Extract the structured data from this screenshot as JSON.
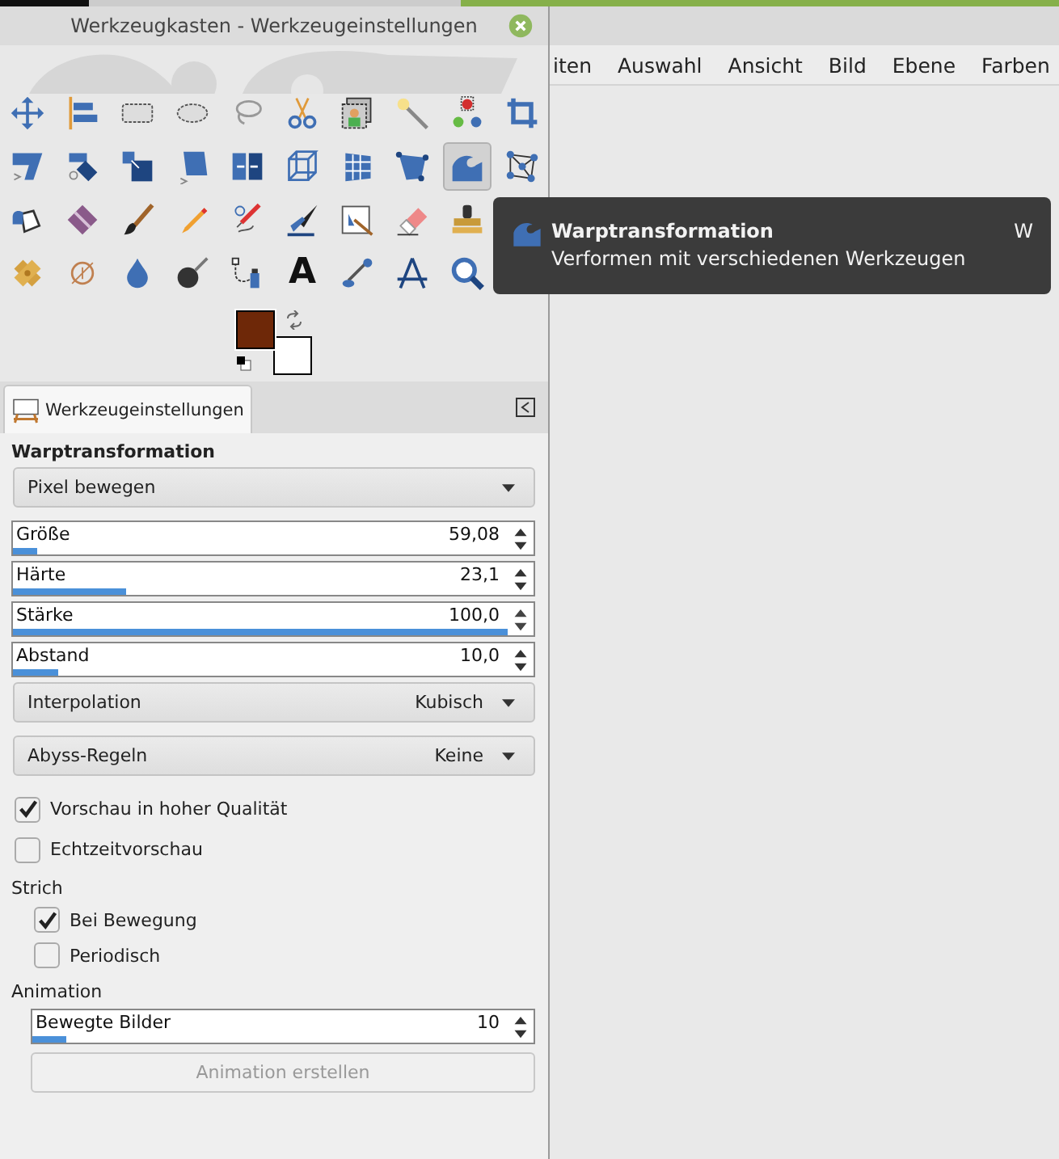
{
  "app_window": {
    "menu_bar": [
      {
        "label": "iten"
      },
      {
        "label": "Auswahl"
      },
      {
        "label": "Ansicht"
      },
      {
        "label": "Bild"
      },
      {
        "label": "Ebene"
      },
      {
        "label": "Farben"
      }
    ]
  },
  "toolbox": {
    "title": "Werkzeugkasten - Werkzeugeinstellungen",
    "tools": [
      {
        "selected": false
      },
      {
        "selected": false
      },
      {
        "selected": false
      },
      {
        "selected": false
      },
      {
        "selected": false
      },
      {
        "selected": false
      },
      {
        "selected": false
      },
      {
        "selected": false
      },
      {
        "selected": false
      },
      {
        "selected": false
      },
      {
        "selected": false
      },
      {
        "selected": false
      },
      {
        "selected": false
      },
      {
        "selected": false
      },
      {
        "selected": false
      },
      {
        "selected": false
      },
      {
        "selected": false
      },
      {
        "selected": false
      },
      {
        "selected": true
      },
      {
        "selected": false
      },
      {
        "selected": false
      },
      {
        "selected": false
      },
      {
        "selected": false
      },
      {
        "selected": false
      },
      {
        "selected": false
      },
      {
        "selected": false
      },
      {
        "selected": false
      },
      {
        "selected": false
      },
      {
        "selected": false
      },
      {
        "selected": false
      },
      {
        "selected": false
      },
      {
        "selected": false
      },
      {
        "selected": false
      },
      {
        "selected": false
      },
      {
        "selected": false,
        "glyph": "A"
      },
      {
        "selected": false
      },
      {
        "selected": false
      },
      {
        "selected": false
      }
    ],
    "swatches": [
      {
        "kind": "foreground",
        "color": "#6e2808"
      },
      {
        "kind": "background",
        "color": "#ffffff"
      }
    ]
  },
  "tabs": [
    {
      "label": "Werkzeugeinstellungen",
      "selected": true
    }
  ],
  "tool_options": {
    "heading": "Warptransformation",
    "options": [
      {
        "kind": "combo",
        "value": "Pixel bewegen"
      },
      {
        "kind": "spin",
        "label": "Größe",
        "value": "59,08",
        "level": 0.05
      },
      {
        "kind": "spin",
        "label": "Härte",
        "value": "23,1",
        "level": 0.23
      },
      {
        "kind": "spin",
        "label": "Stärke",
        "value": "100,0",
        "level": 1.0
      },
      {
        "kind": "spin",
        "label": "Abstand",
        "value": "10,0",
        "level": 0.09
      },
      {
        "kind": "combo",
        "label": "Interpolation",
        "value": "Kubisch"
      },
      {
        "kind": "combo",
        "label": "Abyss-Regeln",
        "value": "Keine"
      },
      {
        "kind": "check",
        "label": "Vorschau in hoher Qualität",
        "checked": true
      },
      {
        "kind": "check",
        "label": "Echtzeitvorschau",
        "checked": false
      },
      {
        "kind": "section",
        "label": "Strich",
        "children": [
          {
            "kind": "check",
            "label": "Bei Bewegung",
            "checked": true
          },
          {
            "kind": "check",
            "label": "Periodisch",
            "checked": false
          }
        ]
      },
      {
        "kind": "section",
        "label": "Animation",
        "children": [
          {
            "kind": "spin",
            "label": "Bewegte Bilder",
            "value": "10",
            "level": 0.07
          },
          {
            "kind": "button",
            "label": "Animation erstellen",
            "disabled": true
          }
        ]
      }
    ]
  },
  "tooltip": {
    "title": "Warptransformation",
    "shortcut": "W",
    "description": "Verformen mit verschiedenen Werkzeugen"
  }
}
